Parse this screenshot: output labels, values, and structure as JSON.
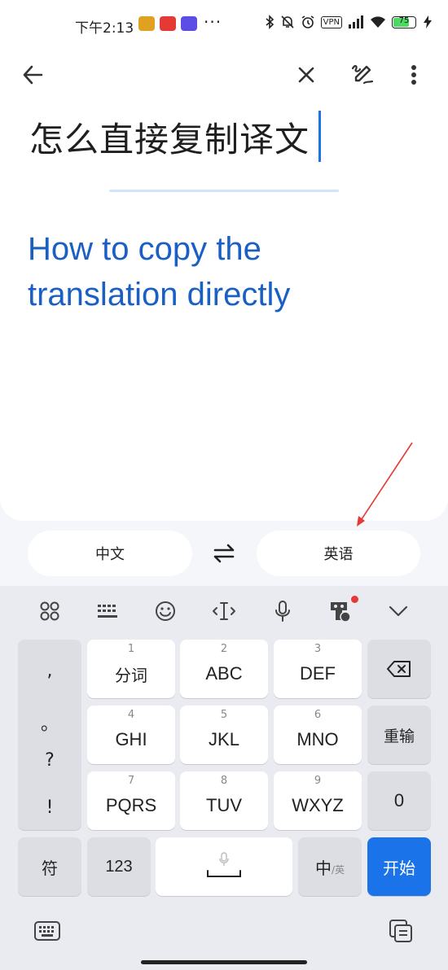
{
  "status_bar": {
    "time": "下午2:13",
    "more": "···",
    "vpn": "VPN",
    "battery": "75",
    "battery_level": 0.75
  },
  "header": {
    "back_icon": "arrow-left-icon",
    "clear_icon": "close-icon",
    "handwrite_icon": "pen-squiggle-icon",
    "menu_icon": "more-vert-icon"
  },
  "source": {
    "text": "怎么直接复制译文"
  },
  "translation": {
    "text": "How to copy the translation directly"
  },
  "languages": {
    "source": "中文",
    "target": "英语",
    "swap_icon": "swap-arrows-icon"
  },
  "keyboard": {
    "toolbar_icons": [
      "apps-grid-icon",
      "keyboard-layout-icon",
      "emoji-icon",
      "text-cursor-icon",
      "microphone-icon",
      "assistant-icon",
      "chevron-down-icon"
    ],
    "punctuation": [
      ",",
      "。",
      "?",
      "!"
    ],
    "rows": [
      [
        {
          "num": "1",
          "label": "分词"
        },
        {
          "num": "2",
          "label": "ABC"
        },
        {
          "num": "3",
          "label": "DEF"
        }
      ],
      [
        {
          "num": "4",
          "label": "GHI"
        },
        {
          "num": "5",
          "label": "JKL"
        },
        {
          "num": "6",
          "label": "MNO"
        }
      ],
      [
        {
          "num": "7",
          "label": "PQRS"
        },
        {
          "num": "8",
          "label": "TUV"
        },
        {
          "num": "9",
          "label": "WXYZ"
        }
      ]
    ],
    "backspace_icon": "backspace-icon",
    "reinput": "重输",
    "zero": "0",
    "symbols": "符",
    "numbers": "123",
    "space_icon": "microphone-icon",
    "lang_toggle_main": "中",
    "lang_toggle_sub": "/英",
    "start": "开始"
  },
  "nav": {
    "left_icon": "keyboard-icon",
    "right_icon": "clipboard-icon"
  },
  "colors": {
    "accent": "#1a73e8",
    "translation": "#1a5fc4",
    "annotation_arrow": "#e53935"
  }
}
